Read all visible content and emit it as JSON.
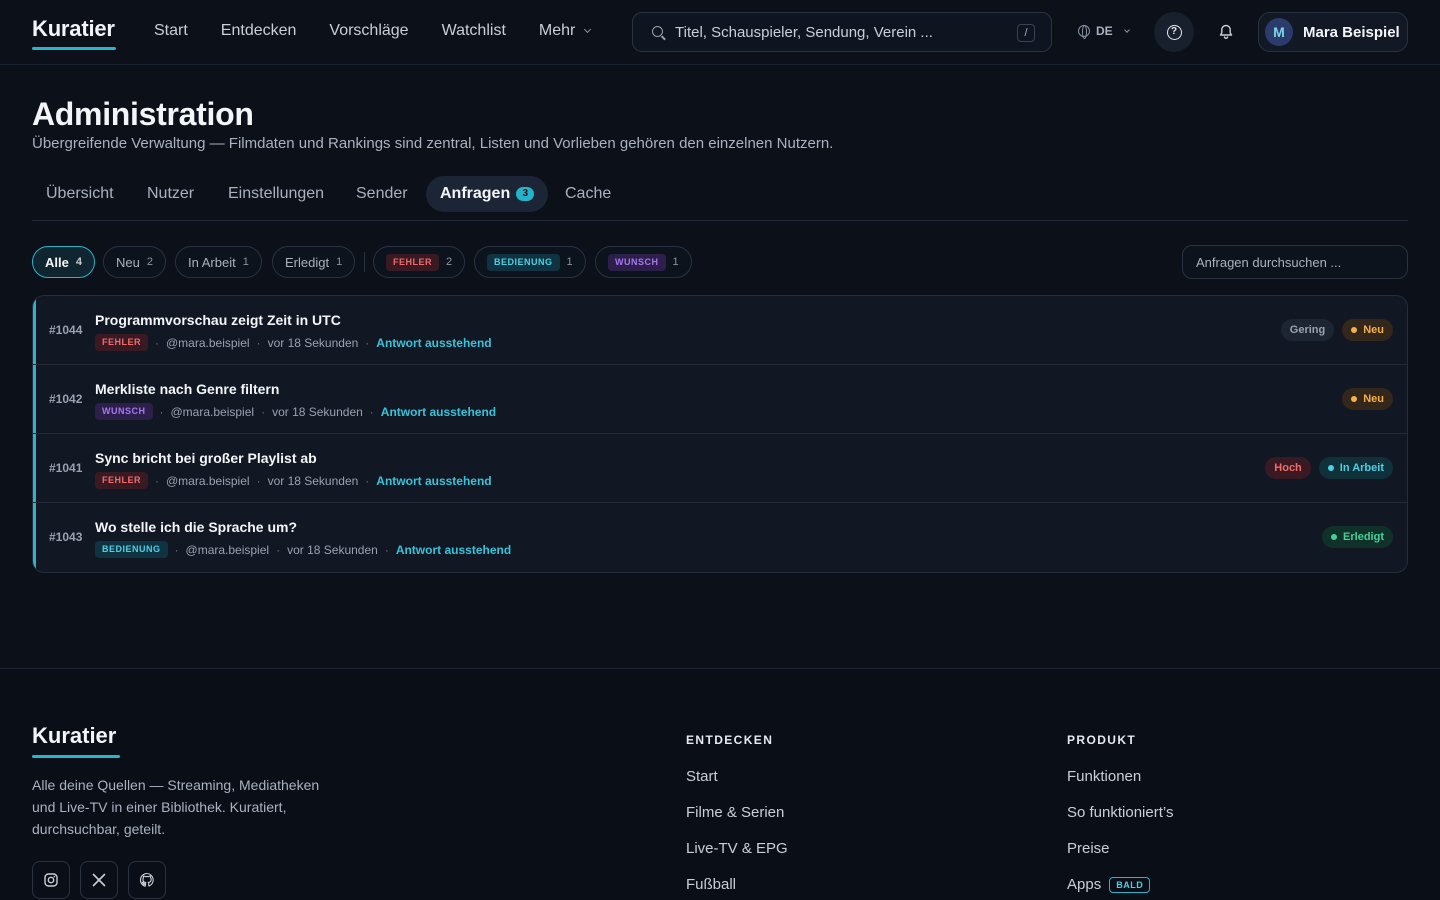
{
  "app": {
    "logo": "Kuratier",
    "nav": [
      "Start",
      "Entdecken",
      "Vorschläge",
      "Watchlist",
      "Mehr"
    ],
    "search": {
      "placeholder": "Titel, Schauspieler, Sendung, Verein ...",
      "shortcut": "/"
    },
    "language": "DE",
    "user": {
      "initial": "M",
      "name": "Mara Beispiel"
    }
  },
  "page": {
    "title": "Administration",
    "subtitle": "Übergreifende Verwaltung — Filmdaten und Rankings sind zentral, Listen und Vorlieben gehören den einzelnen Nutzern.",
    "tabs": [
      {
        "label": "Übersicht"
      },
      {
        "label": "Nutzer"
      },
      {
        "label": "Einstellungen"
      },
      {
        "label": "Sender"
      },
      {
        "label": "Anfragen",
        "badge": "3",
        "active": true
      },
      {
        "label": "Cache"
      }
    ]
  },
  "filters": {
    "status": [
      {
        "label": "Alle",
        "count": "4",
        "active": true
      },
      {
        "label": "Neu",
        "count": "2"
      },
      {
        "label": "In Arbeit",
        "count": "1"
      },
      {
        "label": "Erledigt",
        "count": "1"
      }
    ],
    "types": [
      {
        "label": "FEHLER",
        "count": "2"
      },
      {
        "label": "BEDIENUNG",
        "count": "1"
      },
      {
        "label": "WUNSCH",
        "count": "1"
      }
    ],
    "search_placeholder": "Anfragen durchsuchen ..."
  },
  "requests": [
    {
      "id": "#1044",
      "title": "Programmvorschau zeigt Zeit in UTC",
      "type": "FEHLER",
      "user": "@mara.beispiel",
      "time": "vor 18 Sekunden",
      "reply": "Antwort ausstehend",
      "priority": "Gering",
      "status": "Neu"
    },
    {
      "id": "#1042",
      "title": "Merkliste nach Genre filtern",
      "type": "WUNSCH",
      "user": "@mara.beispiel",
      "time": "vor 18 Sekunden",
      "reply": "Antwort ausstehend",
      "priority": "",
      "status": "Neu"
    },
    {
      "id": "#1041",
      "title": "Sync bricht bei großer Playlist ab",
      "type": "FEHLER",
      "user": "@mara.beispiel",
      "time": "vor 18 Sekunden",
      "reply": "Antwort ausstehend",
      "priority": "Hoch",
      "status": "In Arbeit"
    },
    {
      "id": "#1043",
      "title": "Wo stelle ich die Sprache um?",
      "type": "BEDIENUNG",
      "user": "@mara.beispiel",
      "time": "vor 18 Sekunden",
      "reply": "Antwort ausstehend",
      "priority": "",
      "status": "Erledigt"
    }
  ],
  "footer": {
    "logo": "Kuratier",
    "description": "Alle deine Quellen — Streaming, Mediatheken und Live-TV in einer Bibliothek. Kuratiert, durchsuchbar, geteilt.",
    "social": [
      "instagram-icon",
      "x-icon",
      "github-icon"
    ],
    "columns": [
      {
        "title": "ENTDECKEN",
        "links": [
          "Start",
          "Filme & Serien",
          "Live-TV & EPG",
          "Fußball"
        ]
      },
      {
        "title": "PRODUKT",
        "links": [
          "Funktionen",
          "So funktioniert’s",
          "Preise",
          "Apps"
        ],
        "apps_badge": "BALD"
      }
    ]
  },
  "colors": {
    "accent": "#2bb3c8",
    "background": "#0b1019",
    "error": "#f26b6b",
    "warning": "#f5b04a",
    "success": "#3fd399",
    "wish": "#a477f2"
  }
}
